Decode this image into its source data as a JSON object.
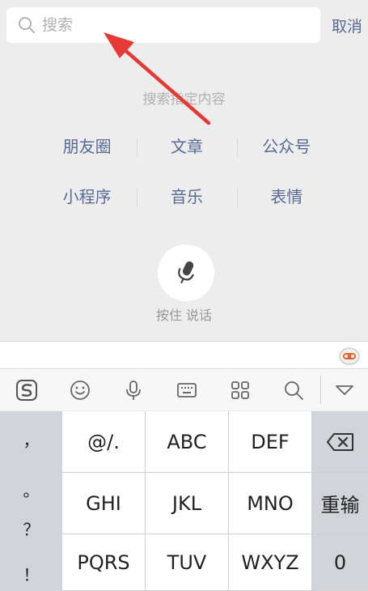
{
  "search": {
    "placeholder": "搜索",
    "value": "",
    "cancel_label": "取消"
  },
  "hint": "搜索指定内容",
  "categories": [
    [
      "朋友圈",
      "文章",
      "公众号"
    ],
    [
      "小程序",
      "音乐",
      "表情"
    ]
  ],
  "voice": {
    "label": "按住 说话"
  },
  "keyboard": {
    "toolbar_icons": [
      "sogou-logo-icon",
      "emoji-icon",
      "microphone-icon",
      "keyboard-icon",
      "grid-icon",
      "search-icon",
      "chevron-down-icon"
    ],
    "side_keys": [
      "，",
      "。",
      "？",
      "！"
    ],
    "rows": [
      [
        "@/.",
        "ABC",
        "DEF"
      ],
      [
        "GHI",
        "JKL",
        "MNO"
      ],
      [
        "PQRS",
        "TUV",
        "WXYZ"
      ]
    ],
    "fn_keys": {
      "backspace_icon": "backspace-icon",
      "reenter": "重输",
      "zero": "0"
    }
  },
  "colors": {
    "link": "#576b95",
    "accent": "#e53935"
  }
}
